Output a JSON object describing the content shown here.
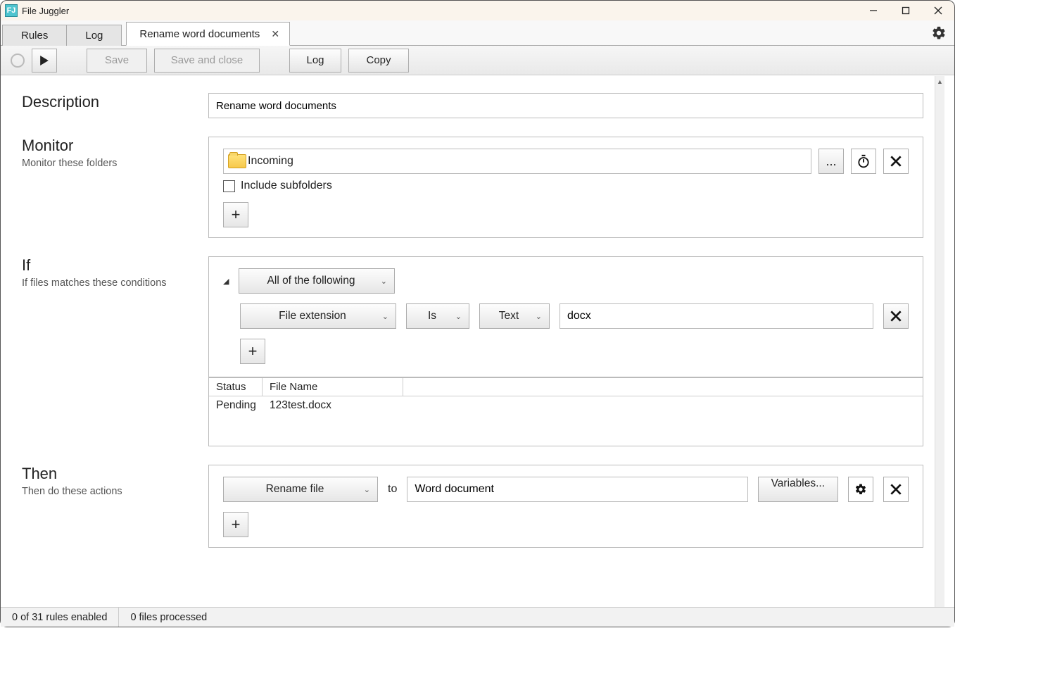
{
  "app": {
    "title": "File Juggler"
  },
  "tabs": {
    "rules": "Rules",
    "log": "Log",
    "doc_title": "Rename word documents"
  },
  "toolbar": {
    "save": "Save",
    "save_close": "Save and close",
    "log": "Log",
    "copy": "Copy"
  },
  "description": {
    "heading": "Description",
    "value": "Rename word documents"
  },
  "monitor": {
    "heading": "Monitor",
    "sub": "Monitor these folders",
    "folder": "Incoming",
    "browse": "...",
    "include_subfolders_label": "Include subfolders",
    "include_subfolders_checked": false
  },
  "if": {
    "heading": "If",
    "sub": "If files matches these conditions",
    "group_mode": "All of the following",
    "condition": {
      "field": "File extension",
      "op": "Is",
      "type": "Text",
      "value": "docx"
    },
    "table": {
      "col_status": "Status",
      "col_filename": "File Name",
      "row_status": "Pending",
      "row_filename": "123test.docx"
    }
  },
  "then": {
    "heading": "Then",
    "sub": "Then do these actions",
    "action": "Rename file",
    "to_label": "to",
    "to_value": "Word document",
    "variables_label": "Variables..."
  },
  "status": {
    "rules_enabled": "0 of 31 rules enabled",
    "files_processed": "0 files processed"
  }
}
